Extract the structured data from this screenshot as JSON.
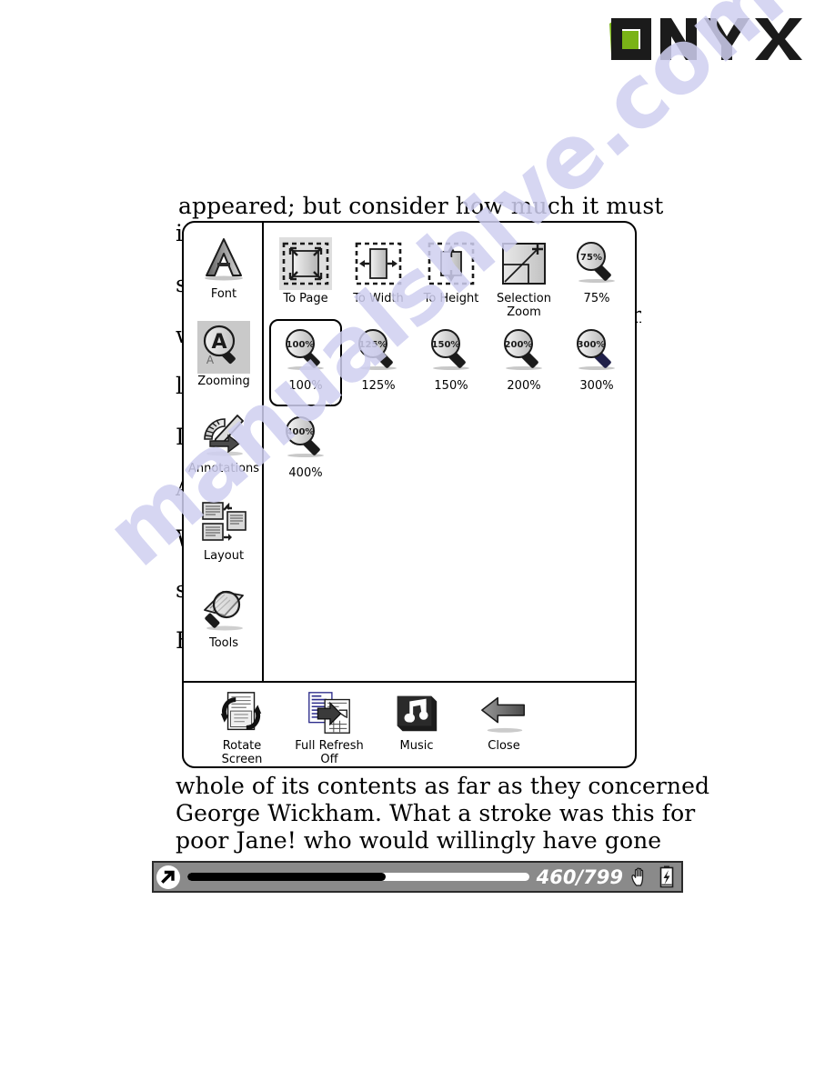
{
  "brand": {
    "logo_text": "ONYX",
    "accent_color": "#7ab317"
  },
  "page_text": {
    "line_top": "appeared; but consider how much it must",
    "line_bottom_1": "whole of its contents as far as they concerned",
    "line_bottom_2": "George Wickham. What a stroke was this for",
    "line_bottom_3": "poor Jane! who would willingly have gone",
    "hidden_left_fragments": [
      "i",
      "s",
      "w",
      "l",
      "I",
      "A",
      "W",
      "s",
      "F"
    ],
    "hidden_right_fragments": [
      "h"
    ]
  },
  "watermark": {
    "text": "manualshive.com",
    "color": "#cfcff0"
  },
  "menu": {
    "categories": [
      {
        "label": "Font",
        "icon": "font-icon",
        "selected": false
      },
      {
        "label": "Zooming",
        "icon": "zooming-icon",
        "selected": true
      },
      {
        "label": "Annotations",
        "icon": "annotations-icon",
        "selected": false
      },
      {
        "label": "Layout",
        "icon": "layout-icon",
        "selected": false
      },
      {
        "label": "Tools",
        "icon": "tools-icon",
        "selected": false
      }
    ],
    "options": [
      {
        "label": "To Page",
        "icon": "fit-to-page-icon",
        "selected": false,
        "highlight": true
      },
      {
        "label": "To Width",
        "icon": "fit-to-width-icon",
        "selected": false,
        "highlight": false
      },
      {
        "label": "To Height",
        "icon": "fit-to-height-icon",
        "selected": false,
        "highlight": false
      },
      {
        "label": "Selection\nZoom",
        "icon": "selection-zoom-icon",
        "selected": false,
        "highlight": false
      },
      {
        "label": "75%",
        "icon": "magnifier-75-icon",
        "selected": false,
        "highlight": false
      },
      {
        "label": "100%",
        "icon": "magnifier-100-icon",
        "selected": true,
        "highlight": false
      },
      {
        "label": "125%",
        "icon": "magnifier-125-icon",
        "selected": false,
        "highlight": false
      },
      {
        "label": "150%",
        "icon": "magnifier-150-icon",
        "selected": false,
        "highlight": false
      },
      {
        "label": "200%",
        "icon": "magnifier-200-icon",
        "selected": false,
        "highlight": false
      },
      {
        "label": "300%",
        "icon": "magnifier-300-icon",
        "selected": false,
        "highlight": false
      },
      {
        "label": "400%",
        "icon": "magnifier-400-icon",
        "selected": false,
        "highlight": false
      }
    ],
    "magnifier_values": [
      "75%",
      "100%",
      "125%",
      "150%",
      "200%",
      "300%",
      "400%"
    ],
    "toolbar": [
      {
        "label": "Rotate\nScreen",
        "icon": "rotate-screen-icon"
      },
      {
        "label": "Full Refresh\nOff",
        "icon": "full-refresh-icon"
      },
      {
        "label": "Music",
        "icon": "music-icon"
      },
      {
        "label": "Close",
        "icon": "back-arrow-icon"
      }
    ]
  },
  "status": {
    "page_counter": "460/799",
    "progress_percent": 58,
    "mode_icon": "hand-icon",
    "battery_icon": "battery-charging-icon",
    "nav_icon": "arrow-up-right-icon"
  }
}
